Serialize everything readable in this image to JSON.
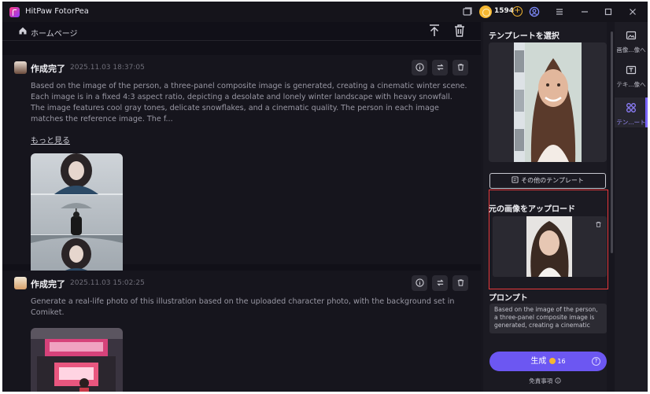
{
  "app": {
    "title": "HitPaw FotorPea",
    "credits": "1594"
  },
  "toolbar": {
    "home_label": "ホームページ"
  },
  "records": [
    {
      "status": "作成完了",
      "date": "2025.11.03  18:37:05",
      "prompt": "Based on the image of the person, a three-panel composite image is generated, creating a cinematic winter scene. Each image is in a fixed 4:3 aspect ratio, depicting a desolate and lonely winter landscape with heavy snowfall. The image features cool gray tones, delicate snowflakes, and a cinematic quality. The person in each image matches the reference image. The f...",
      "more_label": "もっと見る"
    },
    {
      "status": "作成完了",
      "date": "2025.11.03  15:02:25",
      "prompt": "Generate a real-life photo of this illustration based on the uploaded character photo, with the background set in Comiket."
    }
  ],
  "panel": {
    "template_title": "テンプレートを選択",
    "other_templates_label": "その他のテンプレート",
    "upload_title": "元の画像をアップロード",
    "prompt_title": "プロンプト",
    "prompt_text": "Based on the image of the person, a three-panel composite image is generated, creating a cinematic",
    "generate_label": "生成",
    "generate_cost": "16",
    "disclaimer": "免責事項"
  },
  "rail": {
    "items": [
      {
        "label": "画像...像へ"
      },
      {
        "label": "テキ...像へ"
      },
      {
        "label": "テン...ート"
      }
    ]
  },
  "colors": {
    "accent": "#6c57f2",
    "highlight_border": "#e8383b",
    "coin": "#f5b731"
  }
}
